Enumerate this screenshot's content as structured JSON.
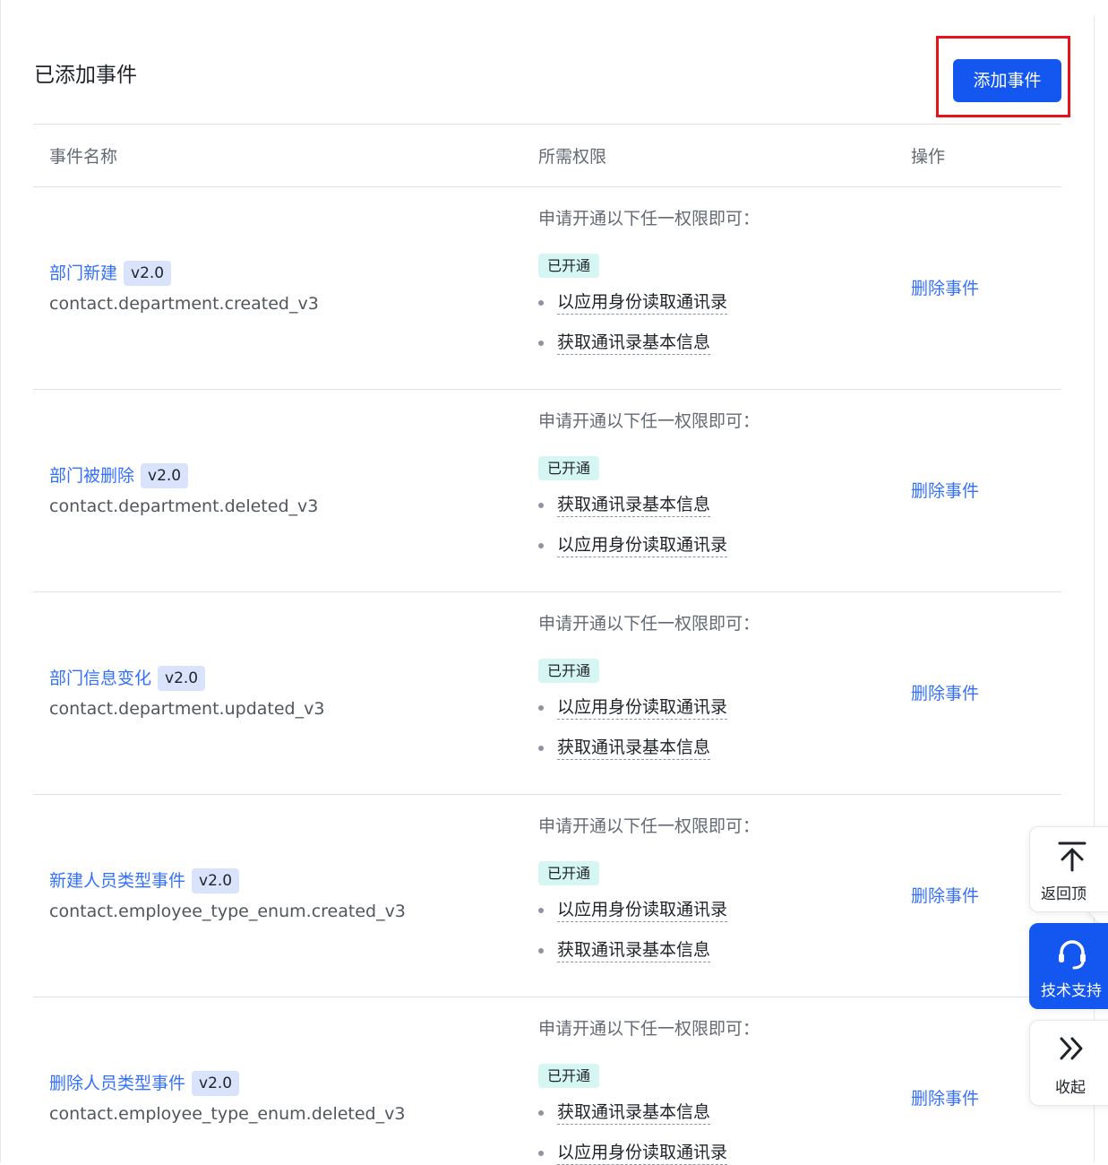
{
  "section": {
    "title": "已添加事件",
    "add_button": "添加事件"
  },
  "table": {
    "headers": {
      "name": "事件名称",
      "permission": "所需权限",
      "action": "操作"
    },
    "rows": [
      {
        "name": "部门新建",
        "version": "v2.0",
        "key": "contact.department.created_v3",
        "perm_hint": "申请开通以下任一权限即可：",
        "status": "已开通",
        "perms": [
          "以应用身份读取通讯录",
          "获取通讯录基本信息"
        ],
        "action": "删除事件"
      },
      {
        "name": "部门被删除",
        "version": "v2.0",
        "key": "contact.department.deleted_v3",
        "perm_hint": "申请开通以下任一权限即可：",
        "status": "已开通",
        "perms": [
          "获取通讯录基本信息",
          "以应用身份读取通讯录"
        ],
        "action": "删除事件"
      },
      {
        "name": "部门信息变化",
        "version": "v2.0",
        "key": "contact.department.updated_v3",
        "perm_hint": "申请开通以下任一权限即可：",
        "status": "已开通",
        "perms": [
          "以应用身份读取通讯录",
          "获取通讯录基本信息"
        ],
        "action": "删除事件"
      },
      {
        "name": "新建人员类型事件",
        "version": "v2.0",
        "key": "contact.employee_type_enum.created_v3",
        "perm_hint": "申请开通以下任一权限即可：",
        "status": "已开通",
        "perms": [
          "以应用身份读取通讯录",
          "获取通讯录基本信息"
        ],
        "action": "删除事件"
      },
      {
        "name": "删除人员类型事件",
        "version": "v2.0",
        "key": "contact.employee_type_enum.deleted_v3",
        "perm_hint": "申请开通以下任一权限即可：",
        "status": "已开通",
        "perms": [
          "获取通讯录基本信息",
          "以应用身份读取通讯录"
        ],
        "action": "删除事件"
      }
    ]
  },
  "float_panel": {
    "back_to_top": "返回顶",
    "support": "技术支持",
    "collapse": "收起"
  },
  "icons": {
    "back_to_top": "arrow-up-to-line-icon",
    "support": "headset-icon",
    "collapse": "double-chevron-right-icon"
  },
  "colors": {
    "primary": "#1456f0",
    "link": "#3370ff",
    "highlight": "#e8121b",
    "status_bg": "#d5f6f2"
  }
}
